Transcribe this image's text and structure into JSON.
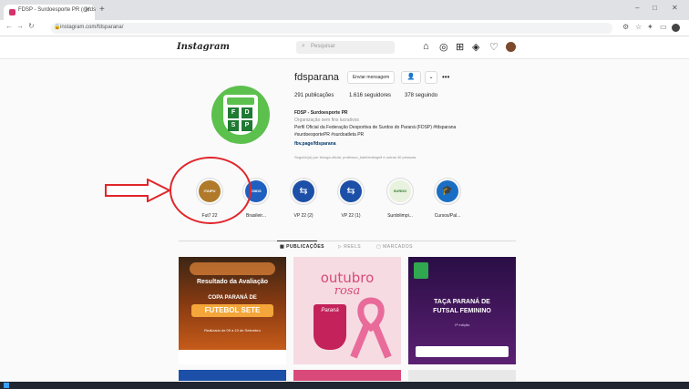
{
  "browser": {
    "tab_title": "FDSP - Surdoesporte PR (@fds",
    "url": "instagram.com/fdsparana/",
    "win_min": "–",
    "win_max": "□",
    "win_close": "✕"
  },
  "instagram": {
    "logo": "Instagram",
    "search_placeholder": "Pesquisar"
  },
  "profile": {
    "username": "fdsparana",
    "message_button": "Enviar mensagem",
    "stats": {
      "posts": "291 publicações",
      "followers": "1.616 seguidores",
      "following": "378 seguindo"
    },
    "bio": {
      "name": "FDSP - Surdoesporte PR",
      "category": "Organização sem fins lucrativos",
      "line1": "Perfil Oficial da Federação Desportiva de Surdos do Paraná (FDSP) #fdsparana",
      "line2": "#surdoesportePR #surdoatleta PR",
      "link": "fbv.page/fdsparana",
      "followed_by": "Seguido(a) por fcbuga.oficial, professor_kalebindiogell e outras 40 pessoas"
    },
    "pfp_letters": [
      "F",
      "D",
      "S",
      "P"
    ]
  },
  "highlights": [
    {
      "label": "Fut7 22",
      "color": "#b07a2a",
      "text": "ITAIPU"
    },
    {
      "label": "Brasileir...",
      "color": "#1f5fbf",
      "text": "CBDS"
    },
    {
      "label": "VP 22 (2)",
      "color": "#1c4fa8",
      "text": "⇆"
    },
    {
      "label": "VP 22 (1)",
      "color": "#1c4fa8",
      "text": "⇆"
    },
    {
      "label": "Surdolimpi...",
      "color": "#e9f2df",
      "text": "SURDO"
    },
    {
      "label": "Cursos/Pal...",
      "color": "#1a6fc4",
      "text": "🎓"
    }
  ],
  "tabs": {
    "posts": "▦ PUBLICAÇÕES",
    "reels": "▷ REELS",
    "tagged": "▢ MARCADOS"
  },
  "posts": [
    {
      "title": "Resultado da Avaliação",
      "subtitle": "COPA PARANÁ DE",
      "headline": "FUTEBOL SETE",
      "footer": "Realizado de 09 a 10 de Setembro"
    },
    {
      "title": "outubro",
      "subtitle": "rosa",
      "brand": "Paraná"
    },
    {
      "title": "TAÇA PARANÁ DE",
      "headline": "FUTSAL FEMININO",
      "footer": "1ª edição"
    }
  ]
}
